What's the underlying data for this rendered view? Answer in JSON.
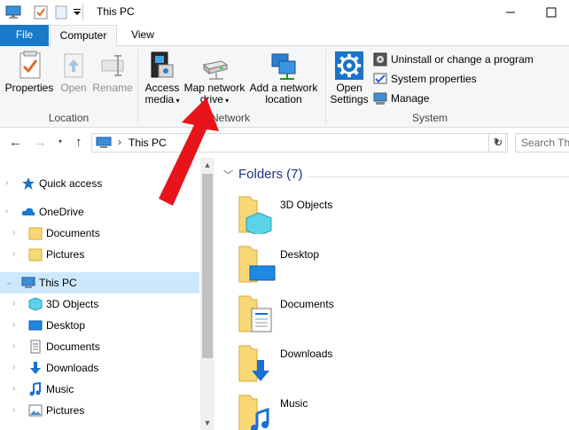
{
  "window": {
    "title": "This PC"
  },
  "ribbon_tabs": [
    "File",
    "Computer",
    "View"
  ],
  "ribbon": {
    "location": {
      "label": "Location",
      "buttons": [
        {
          "label": "Properties",
          "icon": "properties-icon",
          "enabled": true
        },
        {
          "label": "Open",
          "icon": "open-icon",
          "enabled": false
        },
        {
          "label": "Rename",
          "icon": "rename-icon",
          "enabled": false
        }
      ]
    },
    "network": {
      "label": "Network",
      "buttons": [
        {
          "label_line1": "Access",
          "label_line2": "media",
          "icon": "access-media-icon"
        },
        {
          "label_line1": "Map network",
          "label_line2": "drive",
          "icon": "map-network-drive-icon"
        },
        {
          "label_line1": "Add a network",
          "label_line2": "location",
          "icon": "add-network-location-icon"
        }
      ]
    },
    "system": {
      "label": "System",
      "open_settings_line1": "Open",
      "open_settings_line2": "Settings",
      "items": [
        "Uninstall or change a program",
        "System properties",
        "Manage"
      ]
    }
  },
  "navbar": {
    "breadcrumb": "This PC",
    "search_placeholder": "Search Thi"
  },
  "nav_tree": [
    {
      "label": "Quick access",
      "icon": "star-icon",
      "indent": 0
    },
    {
      "label": "OneDrive",
      "icon": "cloud-icon",
      "indent": 0
    },
    {
      "label": "Documents",
      "icon": "folder-icon",
      "indent": 1
    },
    {
      "label": "Pictures",
      "icon": "folder-icon",
      "indent": 1
    },
    {
      "label": "This PC",
      "icon": "computer-icon",
      "indent": 0,
      "selected": true
    },
    {
      "label": "3D Objects",
      "icon": "3d-objects-icon",
      "indent": 1
    },
    {
      "label": "Desktop",
      "icon": "desktop-icon",
      "indent": 1
    },
    {
      "label": "Documents",
      "icon": "documents-icon",
      "indent": 1
    },
    {
      "label": "Downloads",
      "icon": "downloads-icon",
      "indent": 1
    },
    {
      "label": "Music",
      "icon": "music-icon",
      "indent": 1
    },
    {
      "label": "Pictures",
      "icon": "pictures-icon",
      "indent": 1
    }
  ],
  "content": {
    "section_title": "Folders (7)",
    "folders": [
      {
        "label": "3D Objects",
        "icon": "3d-objects-folder-icon"
      },
      {
        "label": "Desktop",
        "icon": "desktop-folder-icon"
      },
      {
        "label": "Documents",
        "icon": "documents-folder-icon"
      },
      {
        "label": "Downloads",
        "icon": "downloads-folder-icon"
      },
      {
        "label": "Music",
        "icon": "music-folder-icon"
      }
    ]
  },
  "colors": {
    "file_tab": "#1979ca",
    "selected": "#cce8ff",
    "folder": "#f8d775",
    "annotation_arrow": "#e8141b"
  }
}
